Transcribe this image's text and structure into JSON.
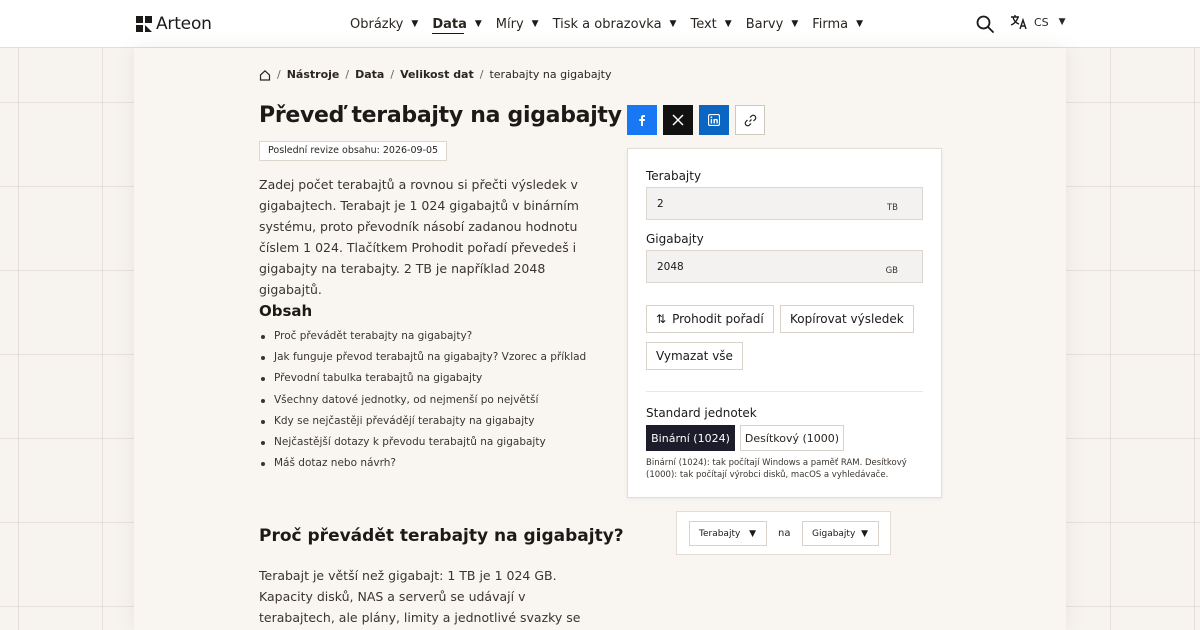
{
  "header": {
    "brand": "Arteon",
    "nav": [
      {
        "label": "Obrázky",
        "active": false
      },
      {
        "label": "Data",
        "active": true
      },
      {
        "label": "Míry",
        "active": false
      },
      {
        "label": "Tisk a obrazovka",
        "active": false
      },
      {
        "label": "Text",
        "active": false
      },
      {
        "label": "Barvy",
        "active": false
      },
      {
        "label": "Firma",
        "active": false
      }
    ],
    "lang": "CS",
    "caret": "▼"
  },
  "breadcrumb": {
    "items": [
      "Nástroje",
      "Data",
      "Velikost dat",
      "terabajty na gigabajty"
    ],
    "separator": "/"
  },
  "page": {
    "title": "Převeď terabajty na gigabajty",
    "revision": "Poslední revize obsahu: 2026-09-05",
    "intro": "Zadej počet terabajtů a rovnou si přečti výsledek v gigabajtech. Terabajt je 1 024 gigabajtů v binárním systému, proto převodník násobí zadanou hodnotu číslem 1 024. Tlačítkem Prohodit pořadí převedeš i gigabajty na terabajty. 2 TB je například 2048 gigabajtů."
  },
  "toc": {
    "title": "Obsah",
    "items": [
      "Proč převádět terabajty na gigabajty?",
      "Jak funguje převod terabajtů na gigabajty? Vzorec a příklad",
      "Převodní tabulka terabajtů na gigabajty",
      "Všechny datové jednotky, od nejmenší po největší",
      "Kdy se nejčastěji převádějí terabajty na gigabajty",
      "Nejčastější dotazy k převodu terabajtů na gigabajty",
      "Máš dotaz nebo návrh?"
    ]
  },
  "section": {
    "title": "Proč převádět terabajty na gigabajty?",
    "body": "Terabajt je větší než gigabajt: 1 TB je 1 024 GB. Kapacity disků, NAS a serverů se udávají v terabajtech, ale plány, limity a jednotlivé svazky se často popisují v gigabajtech —"
  },
  "share": {
    "icons": [
      "facebook-icon",
      "x-icon",
      "linkedin-icon",
      "link-icon"
    ],
    "colors": {
      "facebook": "#1877f2",
      "x": "#111111",
      "linkedin": "#0a66c2"
    }
  },
  "converter": {
    "from": {
      "label": "Terabajty",
      "value": "2",
      "unit": "TB"
    },
    "to": {
      "label": "Gigabajty",
      "value": "2048",
      "unit": "GB"
    },
    "buttons": {
      "swap": "Prohodit pořadí",
      "copy": "Kopírovat výsledek",
      "clear": "Vymazat vše"
    },
    "standard": {
      "label": "Standard jednotek",
      "options": [
        {
          "label": "Binární (1024)",
          "selected": true
        },
        {
          "label": "Desítkový (1000)",
          "selected": false
        }
      ],
      "note": "Binární (1024): tak počítají Windows a paměť RAM. Desítkový (1000): tak počítají výrobci disků, macOS a vyhledávače."
    }
  },
  "selector": {
    "from": "Terabajty",
    "connector": "na",
    "to": "Gigabajty"
  }
}
